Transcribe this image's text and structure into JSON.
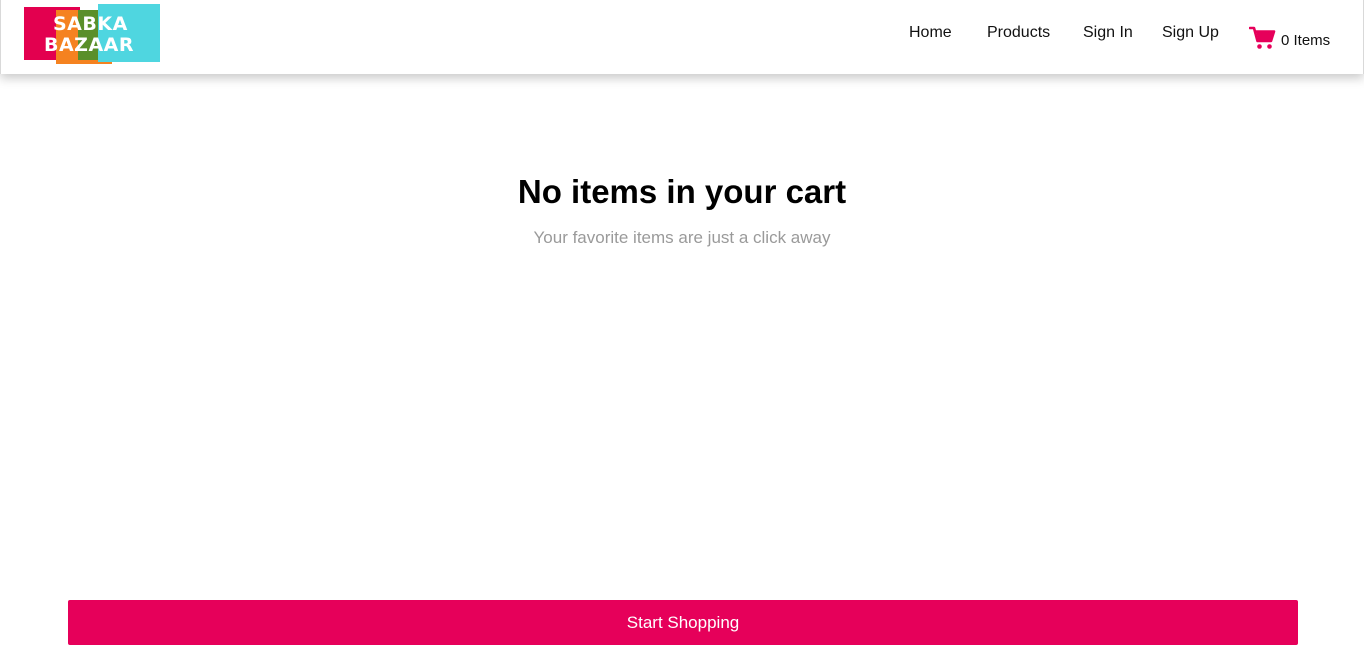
{
  "header": {
    "logo": {
      "line1": "SABKA",
      "line2": "BAZAAR"
    },
    "nav": [
      {
        "label": "Home"
      },
      {
        "label": "Products"
      },
      {
        "label": "Sign In"
      },
      {
        "label": "Sign Up"
      }
    ],
    "cart": {
      "icon": "shopping-cart-icon",
      "label": "0 Items",
      "icon_color": "#e6005a"
    }
  },
  "main": {
    "title": "No items in your cart",
    "subtitle": "Your favorite items are just a click away",
    "button_label": "Start Shopping",
    "button_color": "#e6005a"
  }
}
